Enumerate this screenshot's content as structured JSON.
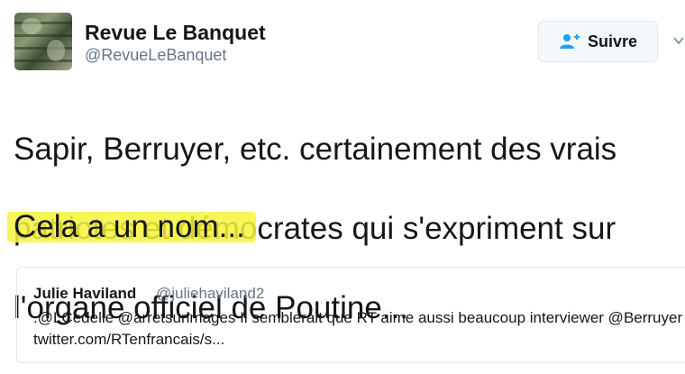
{
  "author": {
    "name": "Revue Le Banquet",
    "handle": "@RevueLeBanquet"
  },
  "follow_button": {
    "label": "Suivre",
    "icon": "add-user-icon"
  },
  "tweet": {
    "lines": [
      "Sapir, Berruyer, etc. certainement des vrais",
      "patriotes et démocrates qui s'expriment sur",
      "l'organe officiel de Poutine..."
    ],
    "highlighted_line": "Cela a un nom...",
    "highlight_color": "#f6f33b"
  },
  "quoted_tweet": {
    "name": "Julie Haviland",
    "handle": "@juliehaviland2",
    "text": ".@LCedelle @arretsurimages Il semblerait que RT aime aussi beaucoup interviewer @Berruyer ..  twitter.com/RTenfrancais/s..."
  },
  "colors": {
    "text": "#14171a",
    "secondary": "#657786",
    "accent": "#1da1f2",
    "border": "#e1e8ed"
  }
}
